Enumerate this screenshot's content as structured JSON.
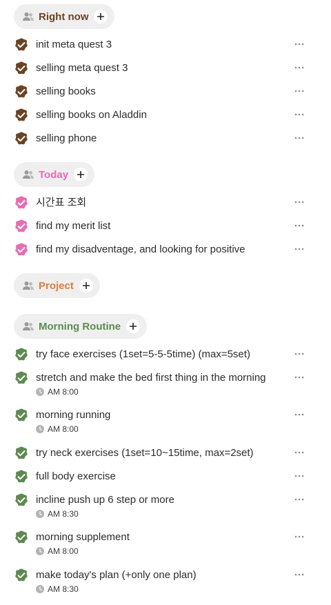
{
  "colors": {
    "brown": "#6b4323",
    "pink": "#ea6bb2",
    "orange": "#e27a3c",
    "green": "#5d8a4e",
    "header_bg": "#efefef",
    "text": "#2b2b2b"
  },
  "sections": [
    {
      "title": "Right now",
      "color": "brown",
      "icon": "people-icon",
      "tasks": [
        {
          "label": "init meta quest 3"
        },
        {
          "label": "selling meta quest 3"
        },
        {
          "label": "selling books"
        },
        {
          "label": "selling books on Aladdin"
        },
        {
          "label": "selling phone"
        }
      ]
    },
    {
      "title": "Today",
      "color": "pink",
      "icon": "people-icon",
      "tasks": [
        {
          "label": "시간표 조회"
        },
        {
          "label": "find my merit list"
        },
        {
          "label": "find my disadventage, and looking for positive"
        }
      ]
    },
    {
      "title": "Project",
      "color": "orange",
      "icon": "people-icon",
      "tasks": []
    },
    {
      "title": "Morning Routine",
      "color": "green",
      "icon": "people-icon",
      "tasks": [
        {
          "label": "try face exercises (1set=5-5-5time) (max=5set)"
        },
        {
          "label": "stretch and make the bed first thing in the morning",
          "time": "AM 8:00"
        },
        {
          "label": "morning running",
          "time": "AM 8:00"
        },
        {
          "label": "try neck exercises (1set=10~15time, max=2set)"
        },
        {
          "label": "full body exercise"
        },
        {
          "label": "incline push up 6 step or more",
          "time": "AM 8:30"
        },
        {
          "label": "morning supplement",
          "time": "AM 8:00"
        },
        {
          "label": "make today's plan (+only one plan)",
          "time": "AM 8:30"
        }
      ]
    }
  ]
}
